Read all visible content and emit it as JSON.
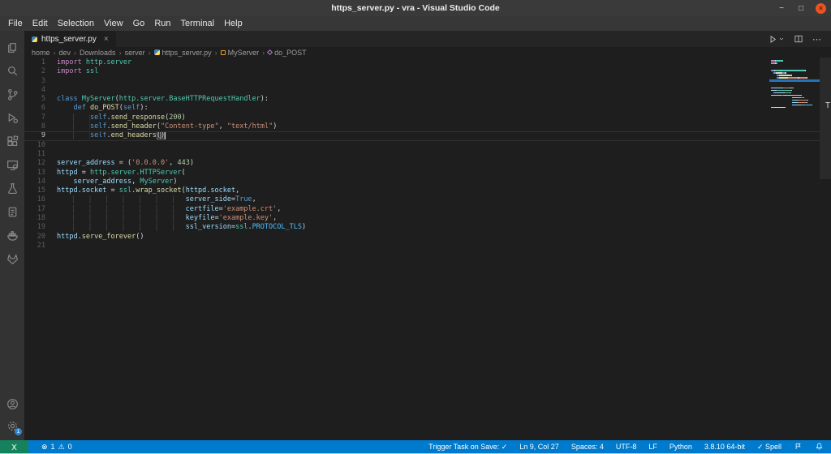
{
  "window": {
    "title": "https_server.py - vra - Visual Studio Code",
    "controls": {
      "minimize": "−",
      "maximize": "□",
      "close": "×"
    }
  },
  "menu": {
    "items": [
      "File",
      "Edit",
      "Selection",
      "View",
      "Go",
      "Run",
      "Terminal",
      "Help"
    ]
  },
  "activity_bar": {
    "icons": [
      "explorer",
      "search",
      "source-control",
      "run-and-debug",
      "extensions",
      "remote-explorer",
      "testing",
      "snippets",
      "docker",
      "gitlab"
    ],
    "bottom_icons": [
      "account",
      "settings"
    ],
    "settings_badge": "1"
  },
  "tab": {
    "label": "https_server.py",
    "icon": "python",
    "close": "×",
    "active": true
  },
  "editor_actions": {
    "run": "run-button",
    "split": "split-editor-button",
    "more": "⋯"
  },
  "breadcrumb": {
    "separator": "›",
    "items": [
      {
        "label": "home"
      },
      {
        "label": "dev"
      },
      {
        "label": "Downloads"
      },
      {
        "label": "server"
      },
      {
        "label": "https_server.py",
        "icon": "python"
      },
      {
        "label": "MyServer",
        "icon": "class"
      },
      {
        "label": "do_POST",
        "icon": "method"
      }
    ]
  },
  "editor": {
    "active_line": 9,
    "cursor": {
      "line": 9,
      "col": 27
    },
    "token_colors": {
      "kw": "#569CD6",
      "kw2": "#C586C0",
      "type": "#4EC9B0",
      "fn": "#DCDCAA",
      "var": "#9CDCFE",
      "str": "#CE9178",
      "num": "#B5CEA8",
      "const": "#4FC1FF",
      "pun": "#D4D4D4",
      "self": "#569CD6",
      "ind0": "#1e1e1e",
      "ind": "#1e1e1e",
      "bh": "#D4D4D4"
    },
    "lines": [
      [
        [
          "kw2",
          "import"
        ],
        [
          "pun",
          " "
        ],
        [
          "type",
          "http.server"
        ]
      ],
      [
        [
          "kw2",
          "import"
        ],
        [
          "pun",
          " "
        ],
        [
          "type",
          "ssl"
        ]
      ],
      [],
      [],
      [
        [
          "kw",
          "class"
        ],
        [
          "pun",
          " "
        ],
        [
          "type",
          "MyServer"
        ],
        [
          "pun",
          "("
        ],
        [
          "type",
          "http.server.BaseHTTPRequestHandler"
        ],
        [
          "pun",
          "):"
        ]
      ],
      [
        [
          "ind0",
          "    "
        ],
        [
          "kw",
          "def"
        ],
        [
          "pun",
          " "
        ],
        [
          "fn",
          "do_POST"
        ],
        [
          "pun",
          "("
        ],
        [
          "self",
          "self"
        ],
        [
          "pun",
          "):"
        ]
      ],
      [
        [
          "ind0",
          "    "
        ],
        [
          "ind",
          "    "
        ],
        [
          "self",
          "self"
        ],
        [
          "pun",
          "."
        ],
        [
          "fn",
          "send_response"
        ],
        [
          "pun",
          "("
        ],
        [
          "num",
          "200"
        ],
        [
          "pun",
          ")"
        ]
      ],
      [
        [
          "ind0",
          "    "
        ],
        [
          "ind",
          "    "
        ],
        [
          "self",
          "self"
        ],
        [
          "pun",
          "."
        ],
        [
          "fn",
          "send_header"
        ],
        [
          "pun",
          "("
        ],
        [
          "str",
          "\"Content-type\""
        ],
        [
          "pun",
          ", "
        ],
        [
          "str",
          "\"text/html\""
        ],
        [
          "pun",
          ")"
        ]
      ],
      [
        [
          "ind0",
          "    "
        ],
        [
          "ind",
          "    "
        ],
        [
          "self",
          "self"
        ],
        [
          "pun",
          "."
        ],
        [
          "fn",
          "end_headers"
        ],
        [
          "bh",
          "("
        ],
        [
          "bh",
          ")"
        ]
      ],
      [],
      [],
      [
        [
          "var",
          "server_address"
        ],
        [
          "pun",
          " = ("
        ],
        [
          "str",
          "'0.0.0.0'"
        ],
        [
          "pun",
          ", "
        ],
        [
          "num",
          "443"
        ],
        [
          "pun",
          ")"
        ]
      ],
      [
        [
          "var",
          "httpd"
        ],
        [
          "pun",
          " = "
        ],
        [
          "type",
          "http.server.HTTPServer"
        ],
        [
          "pun",
          "("
        ]
      ],
      [
        [
          "ind0",
          "    "
        ],
        [
          "var",
          "server_address"
        ],
        [
          "pun",
          ", "
        ],
        [
          "type",
          "MyServer"
        ],
        [
          "pun",
          ")"
        ]
      ],
      [
        [
          "var",
          "httpd"
        ],
        [
          "pun",
          "."
        ],
        [
          "var",
          "socket"
        ],
        [
          "pun",
          " = "
        ],
        [
          "type",
          "ssl"
        ],
        [
          "pun",
          "."
        ],
        [
          "fn",
          "wrap_socket"
        ],
        [
          "pun",
          "("
        ],
        [
          "var",
          "httpd"
        ],
        [
          "pun",
          "."
        ],
        [
          "var",
          "socket"
        ],
        [
          "pun",
          ","
        ]
      ],
      [
        [
          "ind0",
          "    "
        ],
        [
          "ind",
          "                           "
        ],
        [
          "var",
          "server_side"
        ],
        [
          "pun",
          "="
        ],
        [
          "kw",
          "True"
        ],
        [
          "pun",
          ","
        ]
      ],
      [
        [
          "ind0",
          "    "
        ],
        [
          "ind",
          "                           "
        ],
        [
          "var",
          "certfile"
        ],
        [
          "pun",
          "="
        ],
        [
          "str",
          "'example.crt'"
        ],
        [
          "pun",
          ","
        ]
      ],
      [
        [
          "ind0",
          "    "
        ],
        [
          "ind",
          "                           "
        ],
        [
          "var",
          "keyfile"
        ],
        [
          "pun",
          "="
        ],
        [
          "str",
          "'example.key'"
        ],
        [
          "pun",
          ","
        ]
      ],
      [
        [
          "ind0",
          "    "
        ],
        [
          "ind",
          "                           "
        ],
        [
          "var",
          "ssl_version"
        ],
        [
          "pun",
          "="
        ],
        [
          "type",
          "ssl"
        ],
        [
          "pun",
          "."
        ],
        [
          "const",
          "PROTOCOL_TLS"
        ],
        [
          "pun",
          ")"
        ]
      ],
      [
        [
          "var",
          "httpd"
        ],
        [
          "pun",
          "."
        ],
        [
          "fn",
          "serve_forever"
        ],
        [
          "pun",
          "()"
        ]
      ],
      []
    ],
    "overview_mark": "T"
  },
  "status_bar": {
    "remote_color": "#16825D",
    "bar_color": "#007ACC",
    "problems": {
      "errors": "1",
      "warnings": "0"
    },
    "right_items": [
      {
        "name": "trigger-task-on-save",
        "label": "Trigger Task on Save: ✓"
      },
      {
        "name": "cursor-position",
        "label": "Ln 9, Col 27"
      },
      {
        "name": "indentation",
        "label": "Spaces: 4"
      },
      {
        "name": "encoding",
        "label": "UTF-8"
      },
      {
        "name": "eol",
        "label": "LF"
      },
      {
        "name": "language-mode",
        "label": "Python"
      },
      {
        "name": "python-interpreter",
        "label": "3.8.10 64-bit"
      },
      {
        "name": "spell-checker",
        "label": "✓ Spell"
      },
      {
        "name": "feedback",
        "label": "",
        "icon": "flag"
      },
      {
        "name": "notifications",
        "label": "",
        "icon": "bell"
      }
    ]
  }
}
